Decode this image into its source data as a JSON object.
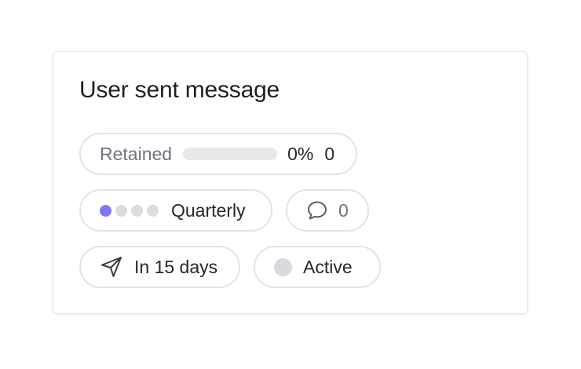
{
  "card": {
    "title": "User sent message",
    "retained": {
      "label": "Retained",
      "progress_fraction": 0,
      "percent_text": "0%",
      "count": "0"
    },
    "frequency": {
      "label": "Quarterly",
      "level_filled": 1,
      "level_total": 4,
      "active_color": "#8176f2",
      "inactive_color": "#dcdce0"
    },
    "comments": {
      "icon": "speech-bubble-icon",
      "count": "0"
    },
    "schedule": {
      "icon": "send-icon",
      "label": "In 15 days"
    },
    "status": {
      "label": "Active",
      "dot_color": "#d9d9de"
    }
  }
}
